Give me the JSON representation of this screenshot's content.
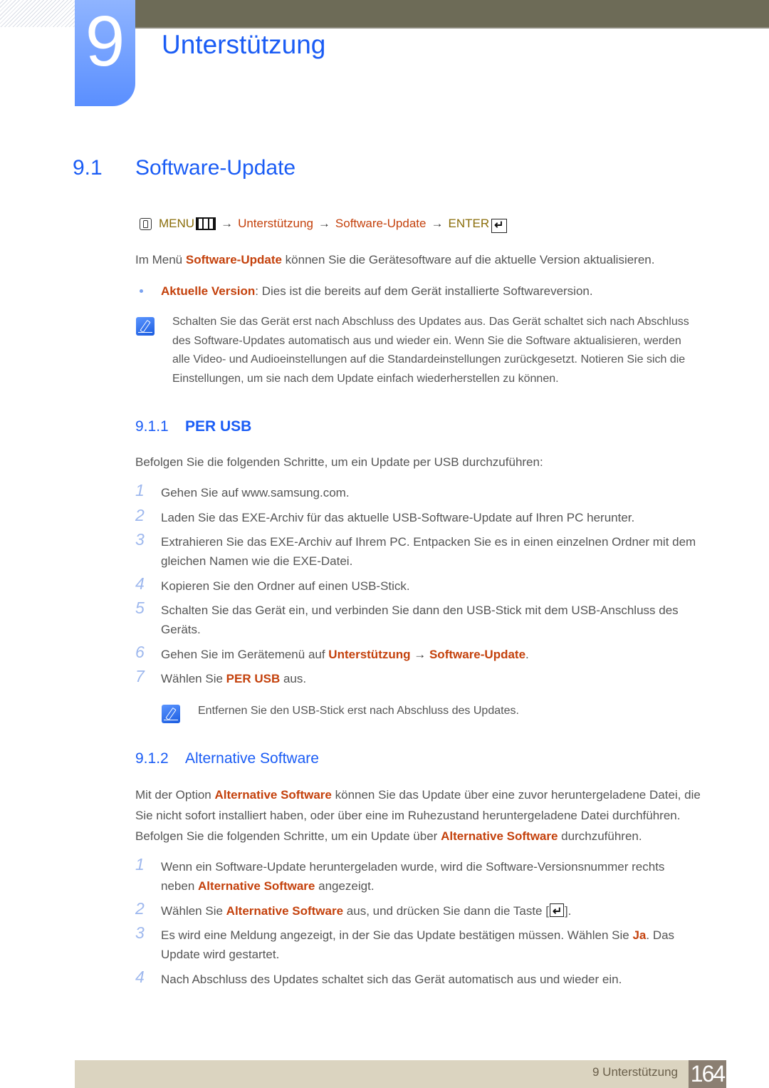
{
  "header": {
    "chapter_number": "9",
    "chapter_title": "Unterstützung"
  },
  "section": {
    "number": "9.1",
    "title": "Software-Update"
  },
  "menu_path": {
    "menu_label": "MENU",
    "step1": "Unterstützung",
    "step2": "Software-Update",
    "enter_label": "ENTER",
    "arrow": "→"
  },
  "intro": {
    "pre": "Im Menü ",
    "highlight": "Software-Update",
    "post": " können Sie die Gerätesoftware auf die aktuelle Version aktualisieren."
  },
  "bullet": {
    "highlight": "Aktuelle Version",
    "text": ": Dies ist die bereits auf dem Gerät installierte Softwareversion."
  },
  "note1": {
    "lines": [
      "Schalten Sie das Gerät erst nach Abschluss des Updates aus. Das Gerät schaltet sich nach Abschluss",
      "des Software-Updates automatisch aus und wieder ein. Wenn Sie die Software aktualisieren, werden",
      "alle Video- und Audioeinstellungen auf die Standardeinstellungen zurückgesetzt. Notieren Sie sich die",
      "Einstellungen, um sie nach dem Update einfach wiederherstellen zu können."
    ]
  },
  "sub1": {
    "number": "9.1.1",
    "title": "PER USB",
    "intro": "Befolgen Sie die folgenden Schritte, um ein Update per USB durchzuführen:",
    "steps": [
      {
        "num": "1",
        "text": "Gehen Sie auf www.samsung.com."
      },
      {
        "num": "2",
        "text": "Laden Sie das EXE-Archiv für das aktuelle USB-Software-Update auf Ihren PC herunter."
      },
      {
        "num": "3",
        "line1": "Extrahieren Sie das EXE-Archiv auf Ihrem PC. Entpacken Sie es in einen einzelnen Ordner mit dem",
        "line2": "gleichen Namen wie die EXE-Datei."
      },
      {
        "num": "4",
        "text": "Kopieren Sie den Ordner auf einen USB-Stick."
      },
      {
        "num": "5",
        "line1": "Schalten Sie das Gerät ein, und verbinden Sie dann den USB-Stick mit dem USB-Anschluss des",
        "line2": "Geräts."
      },
      {
        "num": "6",
        "pre": "Gehen Sie im Gerätemenü auf ",
        "h1": "Unterstützung",
        "arrow": " → ",
        "h2": "Software-Update",
        "post": "."
      },
      {
        "num": "7",
        "pre": "Wählen Sie ",
        "h1": "PER USB",
        "post": " aus."
      }
    ],
    "note": "Entfernen Sie den USB-Stick erst nach Abschluss des Updates."
  },
  "sub2": {
    "number": "9.1.2",
    "title": "Alternative Software",
    "para": {
      "l1_pre": "Mit der Option ",
      "l1_h": "Alternative Software",
      "l1_post": " können Sie das Update über eine zuvor heruntergeladene Datei, die",
      "l2": "Sie nicht sofort installiert haben, oder über eine im Ruhezustand heruntergeladene Datei durchführen.",
      "l3_pre": "Befolgen Sie die folgenden Schritte, um ein Update über ",
      "l3_h": "Alternative Software",
      "l3_post": " durchzuführen."
    },
    "steps": [
      {
        "num": "1",
        "line1": "Wenn ein Software-Update heruntergeladen wurde, wird die Software-Versionsnummer rechts",
        "l2_pre": "neben ",
        "l2_h": "Alternative Software",
        "l2_post": " angezeigt."
      },
      {
        "num": "2",
        "pre": "Wählen Sie ",
        "h": "Alternative Software",
        "mid": " aus, und drücken Sie dann die Taste [",
        "post": "]."
      },
      {
        "num": "3",
        "pre": "Es wird eine Meldung angezeigt, in der Sie das Update bestätigen müssen. Wählen Sie ",
        "h": "Ja",
        "post": ". Das",
        "line2": "Update wird gestartet."
      },
      {
        "num": "4",
        "text": "Nach Abschluss des Updates schaltet sich das Gerät automatisch aus und wieder ein."
      }
    ]
  },
  "footer": {
    "label": "9 Unterstützung",
    "page": "164"
  }
}
